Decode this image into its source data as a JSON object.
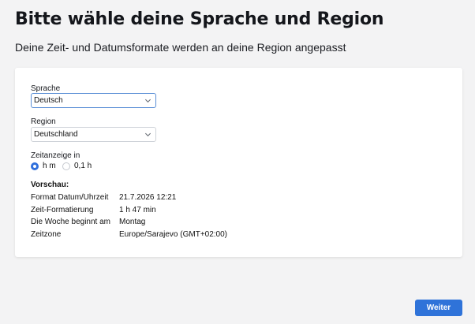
{
  "header": {
    "title": "Bitte wähle deine Sprache und Region",
    "subtitle": "Deine Zeit- und Datumsformate werden an deine Region angepasst"
  },
  "form": {
    "language": {
      "label": "Sprache",
      "value": "Deutsch",
      "icon": "chevron-down-icon"
    },
    "region": {
      "label": "Region",
      "value": "Deutschland",
      "icon": "chevron-down-icon"
    },
    "time_display": {
      "label": "Zeitanzeige in",
      "options": [
        {
          "label": "h m",
          "selected": true
        },
        {
          "label": "0,1 h",
          "selected": false
        }
      ]
    }
  },
  "preview": {
    "title": "Vorschau:",
    "rows": [
      {
        "key": "Format Datum/Uhrzeit",
        "value": "21.7.2026 12:21"
      },
      {
        "key": "Zeit-Formatierung",
        "value": "1 h 47 min"
      },
      {
        "key": "Die Woche beginnt am",
        "value": "Montag"
      },
      {
        "key": "Zeitzone",
        "value": "Europe/Sarajevo (GMT+02:00)"
      }
    ]
  },
  "footer": {
    "next_label": "Weiter"
  },
  "colors": {
    "accent": "#2f73d9",
    "background": "#f3f3f4",
    "card": "#ffffff"
  }
}
